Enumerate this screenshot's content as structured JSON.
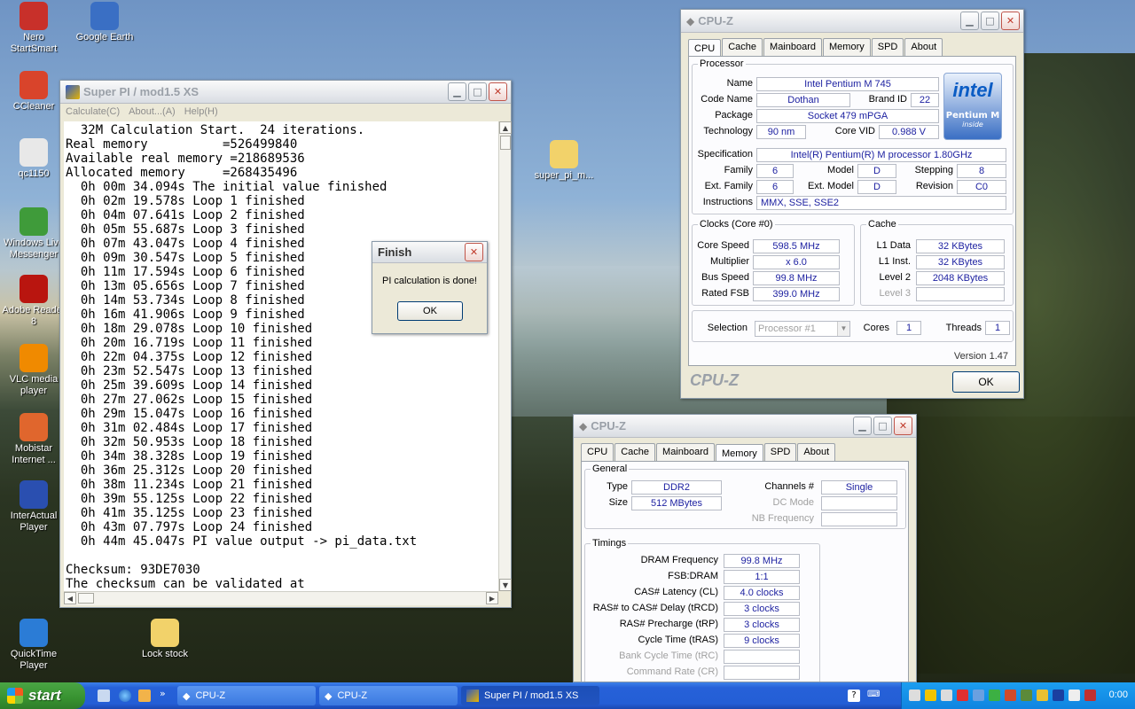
{
  "desktop": {
    "icons": [
      {
        "label": "Nero StartSmart",
        "icon": "nero-icon",
        "color": "#c8302a"
      },
      {
        "label": "Google Earth",
        "icon": "globe-icon",
        "color": "#3a6fc4"
      },
      {
        "label": "CCleaner",
        "icon": "ccleaner-icon",
        "color": "#d9442b"
      },
      {
        "label": "qc1150",
        "icon": "logitech-icon",
        "color": "#e8e8e8"
      },
      {
        "label": "Windows Live Messenger",
        "icon": "messenger-icon",
        "color": "#3f9b3a"
      },
      {
        "label": "Adobe Reader 8",
        "icon": "adobe-reader-icon",
        "color": "#b9150f"
      },
      {
        "label": "VLC media player",
        "icon": "vlc-icon",
        "color": "#f08a00"
      },
      {
        "label": "Mobistar Internet ...",
        "icon": "mobistar-icon",
        "color": "#e0662d"
      },
      {
        "label": "InterActual Player",
        "icon": "interactual-icon",
        "color": "#2a4fb0"
      },
      {
        "label": "QuickTime Player",
        "icon": "quicktime-icon",
        "color": "#2b7cd6"
      },
      {
        "label": "Lock stock",
        "icon": "folder-icon",
        "color": "#f2d26a"
      },
      {
        "label": "super_pi_m...",
        "icon": "folder-icon",
        "color": "#f2d26a"
      }
    ]
  },
  "superpi": {
    "title": "Super PI / mod1.5 XS",
    "menu": [
      "Calculate(C)",
      "About...(A)",
      "Help(H)"
    ],
    "lines": [
      "  32M Calculation Start.  24 iterations.",
      "Real memory          =526499840",
      "Available real memory =218689536",
      "Allocated memory     =268435496",
      "  0h 00m 34.094s The initial value finished",
      "  0h 02m 19.578s Loop 1 finished",
      "  0h 04m 07.641s Loop 2 finished",
      "  0h 05m 55.687s Loop 3 finished",
      "  0h 07m 43.047s Loop 4 finished",
      "  0h 09m 30.547s Loop 5 finished",
      "  0h 11m 17.594s Loop 6 finished",
      "  0h 13m 05.656s Loop 7 finished",
      "  0h 14m 53.734s Loop 8 finished",
      "  0h 16m 41.906s Loop 9 finished",
      "  0h 18m 29.078s Loop 10 finished",
      "  0h 20m 16.719s Loop 11 finished",
      "  0h 22m 04.375s Loop 12 finished",
      "  0h 23m 52.547s Loop 13 finished",
      "  0h 25m 39.609s Loop 14 finished",
      "  0h 27m 27.062s Loop 15 finished",
      "  0h 29m 15.047s Loop 16 finished",
      "  0h 31m 02.484s Loop 17 finished",
      "  0h 32m 50.953s Loop 18 finished",
      "  0h 34m 38.328s Loop 19 finished",
      "  0h 36m 25.312s Loop 20 finished",
      "  0h 38m 11.234s Loop 21 finished",
      "  0h 39m 55.125s Loop 22 finished",
      "  0h 41m 35.125s Loop 23 finished",
      "  0h 43m 07.797s Loop 24 finished",
      "  0h 44m 45.047s PI value output -> pi_data.txt",
      "",
      "Checksum: 93DE7030",
      "The checksum can be validated at"
    ]
  },
  "finish": {
    "title": "Finish",
    "message": "PI calculation is done!",
    "ok": "OK"
  },
  "cpuz1": {
    "title": "CPU-Z",
    "tabs": [
      "CPU",
      "Cache",
      "Mainboard",
      "Memory",
      "SPD",
      "About"
    ],
    "processor_legend": "Processor",
    "name_l": "Name",
    "name": "Intel Pentium M 745",
    "codename_l": "Code Name",
    "codename": "Dothan",
    "brandid_l": "Brand ID",
    "brandid": "22",
    "package_l": "Package",
    "package": "Socket 479 mPGA",
    "tech_l": "Technology",
    "tech": "90 nm",
    "vid_l": "Core VID",
    "vid": "0.988 V",
    "spec_l": "Specification",
    "spec": "Intel(R) Pentium(R) M processor 1.80GHz",
    "family_l": "Family",
    "family": "6",
    "model_l": "Model",
    "model": "D",
    "stepping_l": "Stepping",
    "stepping": "8",
    "extfamily_l": "Ext. Family",
    "extfamily": "6",
    "extmodel_l": "Ext. Model",
    "extmodel": "D",
    "revision_l": "Revision",
    "revision": "C0",
    "instr_l": "Instructions",
    "instr": "MMX, SSE, SSE2",
    "logo": {
      "brand": "intel",
      "line1": "Pentium M",
      "line2": "inside"
    },
    "clocks_legend": "Clocks (Core #0)",
    "corespeed_l": "Core Speed",
    "corespeed": "598.5 MHz",
    "mult_l": "Multiplier",
    "mult": "x 6.0",
    "bus_l": "Bus Speed",
    "bus": "99.8 MHz",
    "fsb_l": "Rated FSB",
    "fsb": "399.0 MHz",
    "cache_legend": "Cache",
    "l1d_l": "L1 Data",
    "l1d": "32 KBytes",
    "l1i_l": "L1 Inst.",
    "l1i": "32 KBytes",
    "l2_l": "Level 2",
    "l2": "2048 KBytes",
    "l3_l": "Level 3",
    "selection_l": "Selection",
    "selection": "Processor #1",
    "cores_l": "Cores",
    "cores": "1",
    "threads_l": "Threads",
    "threads": "1",
    "version": "Version 1.47",
    "brand": "CPU-Z",
    "ok": "OK"
  },
  "cpuz2": {
    "title": "CPU-Z",
    "tabs": [
      "CPU",
      "Cache",
      "Mainboard",
      "Memory",
      "SPD",
      "About"
    ],
    "general_legend": "General",
    "type_l": "Type",
    "type": "DDR2",
    "channels_l": "Channels #",
    "channels": "Single",
    "size_l": "Size",
    "size": "512 MBytes",
    "dcmode_l": "DC Mode",
    "nbfreq_l": "NB Frequency",
    "timings_legend": "Timings",
    "timings": [
      {
        "label": "DRAM Frequency",
        "value": "99.8 MHz",
        "disabled": false
      },
      {
        "label": "FSB:DRAM",
        "value": "1:1",
        "disabled": false
      },
      {
        "label": "CAS# Latency (CL)",
        "value": "4.0 clocks",
        "disabled": false
      },
      {
        "label": "RAS# to CAS# Delay (tRCD)",
        "value": "3 clocks",
        "disabled": false
      },
      {
        "label": "RAS# Precharge (tRP)",
        "value": "3 clocks",
        "disabled": false
      },
      {
        "label": "Cycle Time (tRAS)",
        "value": "9 clocks",
        "disabled": false
      },
      {
        "label": "Bank Cycle Time (tRC)",
        "value": "",
        "disabled": true
      },
      {
        "label": "Command Rate (CR)",
        "value": "",
        "disabled": true
      }
    ]
  },
  "taskbar": {
    "start": "start",
    "tasks": [
      "CPU-Z",
      "CPU-Z",
      "Super PI / mod1.5 XS"
    ],
    "clock": "0:00",
    "colors": {
      "taskbar": "#245ed6",
      "start": "#379230",
      "tray": "#0f84e0"
    }
  }
}
